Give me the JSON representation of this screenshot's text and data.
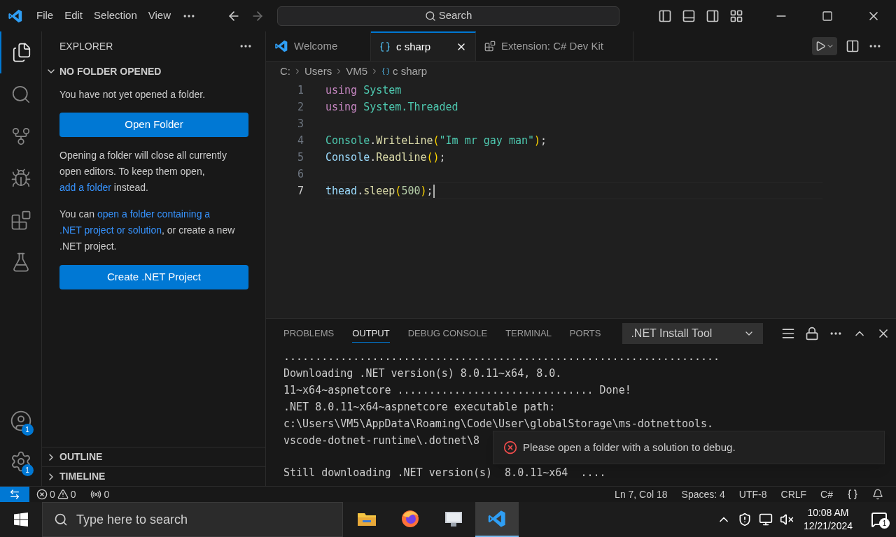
{
  "menu": [
    "File",
    "Edit",
    "Selection",
    "View"
  ],
  "search": {
    "placeholder": "Search"
  },
  "activity_bar": [
    {
      "kind": "explorer",
      "selected": true
    },
    {
      "kind": "search",
      "selected": false
    },
    {
      "kind": "source",
      "selected": false
    },
    {
      "kind": "debug",
      "selected": false
    },
    {
      "kind": "extensions",
      "selected": false
    },
    {
      "kind": "testing",
      "selected": false
    }
  ],
  "activity_bottom": [
    {
      "kind": "accounts",
      "badge": "1"
    },
    {
      "kind": "settings",
      "badge": "1"
    }
  ],
  "sidebar": {
    "title": "EXPLORER",
    "section": "NO FOLDER OPENED",
    "expanded": true,
    "intro": "You have not yet opened a folder.",
    "open_button": "Open Folder",
    "para1": {
      "before": "Opening a folder will close all currently open editors. To keep them open, ",
      "links": [
        "add a folder"
      ],
      "after": " instead."
    },
    "para2": {
      "before": "You can ",
      "links": [
        "open a folder containing a",
        ".NET project or solution"
      ],
      "after": ", or create a new .NET project."
    },
    "create_button": "Create .NET Project",
    "collapsed_sections": [
      {
        "label": "OUTLINE",
        "expanded": false
      },
      {
        "label": "TIMELINE",
        "expanded": false
      }
    ]
  },
  "tabs": [
    {
      "label": "Welcome",
      "kind": "welcome",
      "selected": false
    },
    {
      "label": "c sharp",
      "kind": "csharp",
      "selected": true
    },
    {
      "label": "Extension: C# Dev Kit",
      "kind": "extension",
      "selected": false
    }
  ],
  "breadcrumb": [
    "C:",
    "Users",
    "VM5",
    "c sharp"
  ],
  "code": [
    {
      "number": "1",
      "current": false,
      "tokens": [
        {
          "text": "using",
          "kind": "keyword"
        },
        {
          "text": " System",
          "kind": "type"
        }
      ]
    },
    {
      "number": "2",
      "current": false,
      "tokens": [
        {
          "text": "using",
          "kind": "keyword"
        },
        {
          "text": " System.Threaded",
          "kind": "type"
        }
      ]
    },
    {
      "number": "3",
      "current": false
    },
    {
      "number": "4",
      "current": false,
      "tokens": [
        {
          "text": "Console",
          "kind": "type"
        },
        {
          "text": ".",
          "kind": "plain"
        },
        {
          "text": "WriteLine",
          "kind": "func"
        },
        {
          "text": "(",
          "kind": "bracket"
        },
        {
          "text": "\"Im mr gay man\"",
          "kind": "string"
        },
        {
          "text": ")",
          "kind": "bracket"
        },
        {
          "text": ";",
          "kind": "plain"
        }
      ]
    },
    {
      "number": "5",
      "current": false,
      "tokens": [
        {
          "text": "Console",
          "kind": "variable"
        },
        {
          "text": ".",
          "kind": "plain"
        },
        {
          "text": "Readline",
          "kind": "func"
        },
        {
          "text": "()",
          "kind": "bracket"
        },
        {
          "text": ";",
          "kind": "plain"
        }
      ]
    },
    {
      "number": "6",
      "current": false
    },
    {
      "number": "7",
      "current": true,
      "tokens": [
        {
          "text": "thead",
          "kind": "variable"
        },
        {
          "text": ".",
          "kind": "plain"
        },
        {
          "text": "sleep",
          "kind": "func"
        },
        {
          "text": "(",
          "kind": "bracket"
        },
        {
          "text": "500",
          "kind": "number"
        },
        {
          "text": ")",
          "kind": "bracket"
        },
        {
          "text": ";",
          "kind": "plain"
        }
      ]
    }
  ],
  "panel": {
    "tabs": [
      {
        "label": "PROBLEMS",
        "selected": false
      },
      {
        "label": "OUTPUT",
        "selected": true
      },
      {
        "label": "DEBUG CONSOLE",
        "selected": false
      },
      {
        "label": "TERMINAL",
        "selected": false
      },
      {
        "label": "PORTS",
        "selected": false
      }
    ],
    "channel": ".NET Install Tool",
    "output": [
      {
        "text": "....................................................................."
      },
      {
        "text": "Downloading .NET version(s) 8.0.11~x64, 8.0."
      },
      {
        "text": "11~x64~aspnetcore ............................... Done!"
      },
      {
        "text": ".NET 8.0.11~x64~aspnetcore executable path:"
      },
      {
        "text": "c:\\Users\\VM5\\AppData\\Roaming\\Code\\User\\globalStorage\\ms-dotnettools."
      },
      {
        "text": "vscode-dotnet-runtime\\.dotnet\\8"
      },
      {
        "text": "Still downloading .NET version(s)  8.0.11~x64  ....",
        "gap_before": true
      }
    ]
  },
  "notification": {
    "kind": "error",
    "message": "Please open a folder with a solution to debug."
  },
  "status_bar": {
    "errors": "0",
    "warnings": "0",
    "ports": "0",
    "right": [
      "Ln 7, Col 18",
      "Spaces: 4",
      "UTF-8",
      "CRLF",
      "C#"
    ]
  },
  "taskbar": {
    "search_placeholder": "Type here to search",
    "apps": [
      {
        "kind": "files",
        "selected": false
      },
      {
        "kind": "firefox",
        "selected": false
      },
      {
        "kind": "app",
        "selected": false
      },
      {
        "kind": "vscode",
        "selected": true
      }
    ],
    "time": "10:08 AM",
    "date": "12/21/2024",
    "notifications": "1"
  }
}
